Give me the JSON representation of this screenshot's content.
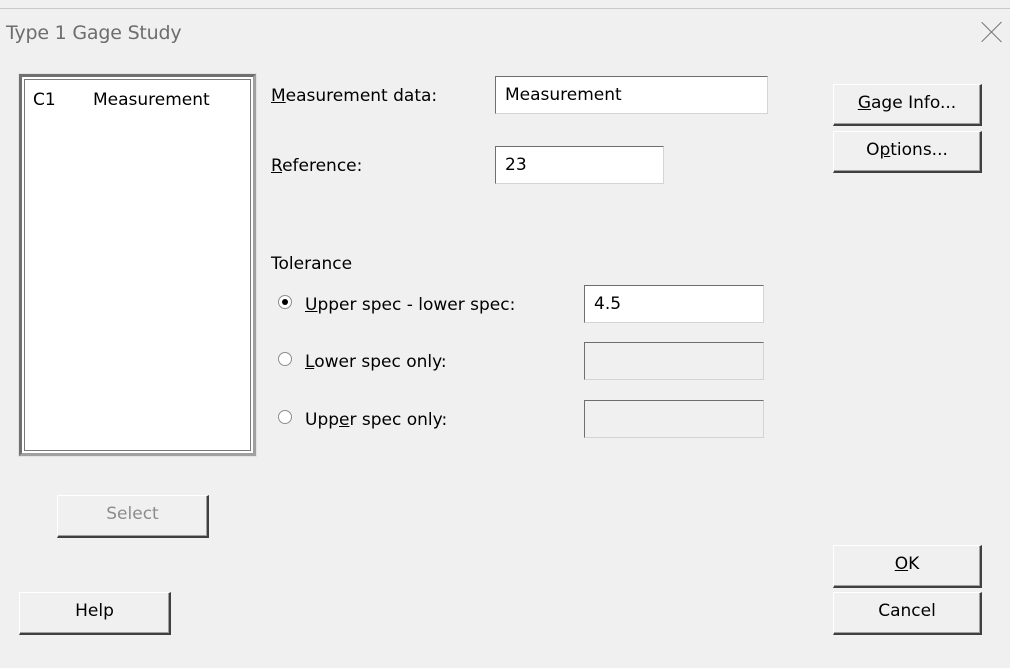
{
  "window": {
    "title": "Type 1 Gage Study"
  },
  "columns_list": [
    {
      "id": "C1",
      "name": "Measurement"
    }
  ],
  "fields": {
    "measurement_data": {
      "label_first": "M",
      "label_rest": "easurement data:",
      "value": "Measurement"
    },
    "reference": {
      "label_first": "R",
      "label_rest": "eference:",
      "value": "23"
    }
  },
  "tolerance": {
    "heading": "Tolerance",
    "options": [
      {
        "pre": "",
        "key": "U",
        "post": "pper spec - lower spec:",
        "value": "4.5",
        "selected": true,
        "enabled": true
      },
      {
        "pre": "",
        "key": "L",
        "post": "ower spec only:",
        "value": "",
        "selected": false,
        "enabled": false
      },
      {
        "pre": "Upp",
        "key": "e",
        "post": "r spec only:",
        "value": "",
        "selected": false,
        "enabled": false
      }
    ]
  },
  "buttons": {
    "gage_info": {
      "key": "G",
      "rest": "age Info..."
    },
    "options": {
      "pre": "O",
      "key": "p",
      "rest": "tions..."
    },
    "select": "Select",
    "help": "Help",
    "ok": {
      "key": "O",
      "rest": "K"
    },
    "cancel": "Cancel"
  }
}
